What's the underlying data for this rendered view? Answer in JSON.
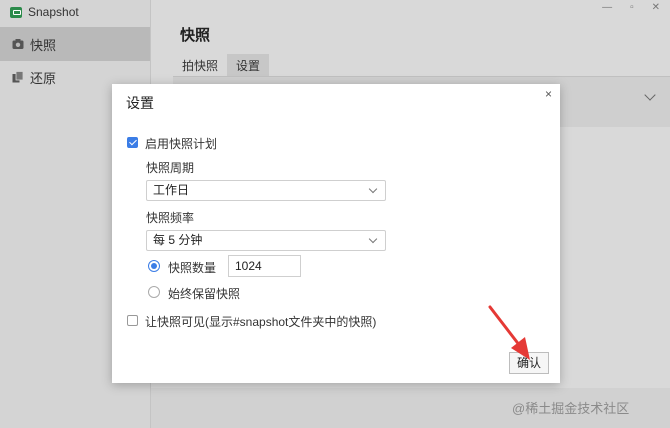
{
  "app": {
    "name": "Snapshot",
    "window_controls": [
      "—",
      "▫",
      "✕"
    ]
  },
  "sidebar": {
    "items": [
      {
        "label": "快照",
        "icon": "camera-icon",
        "active": true
      },
      {
        "label": "还原",
        "icon": "restore-icon",
        "active": false
      }
    ]
  },
  "main": {
    "title": "快照",
    "tabs": [
      {
        "label": "拍快照",
        "active": false
      },
      {
        "label": "设置",
        "active": true
      }
    ]
  },
  "dialog": {
    "title": "设置",
    "close": "×",
    "enable_label": "启用快照计划",
    "enable_checked": true,
    "period_label": "快照周期",
    "period_value": "工作日",
    "frequency_label": "快照频率",
    "frequency_value": "每 5 分钟",
    "count_label": "快照数量",
    "count_value": "1024",
    "count_selected": true,
    "keep_label": "始终保留快照",
    "keep_selected": false,
    "visible_label": "让快照可见(显示#snapshot文件夹中的快照)",
    "visible_checked": false,
    "confirm_label": "确认"
  },
  "colors": {
    "accent": "#3b7de6",
    "annotation_arrow": "#e53935"
  },
  "watermark": "@稀土掘金技术社区"
}
